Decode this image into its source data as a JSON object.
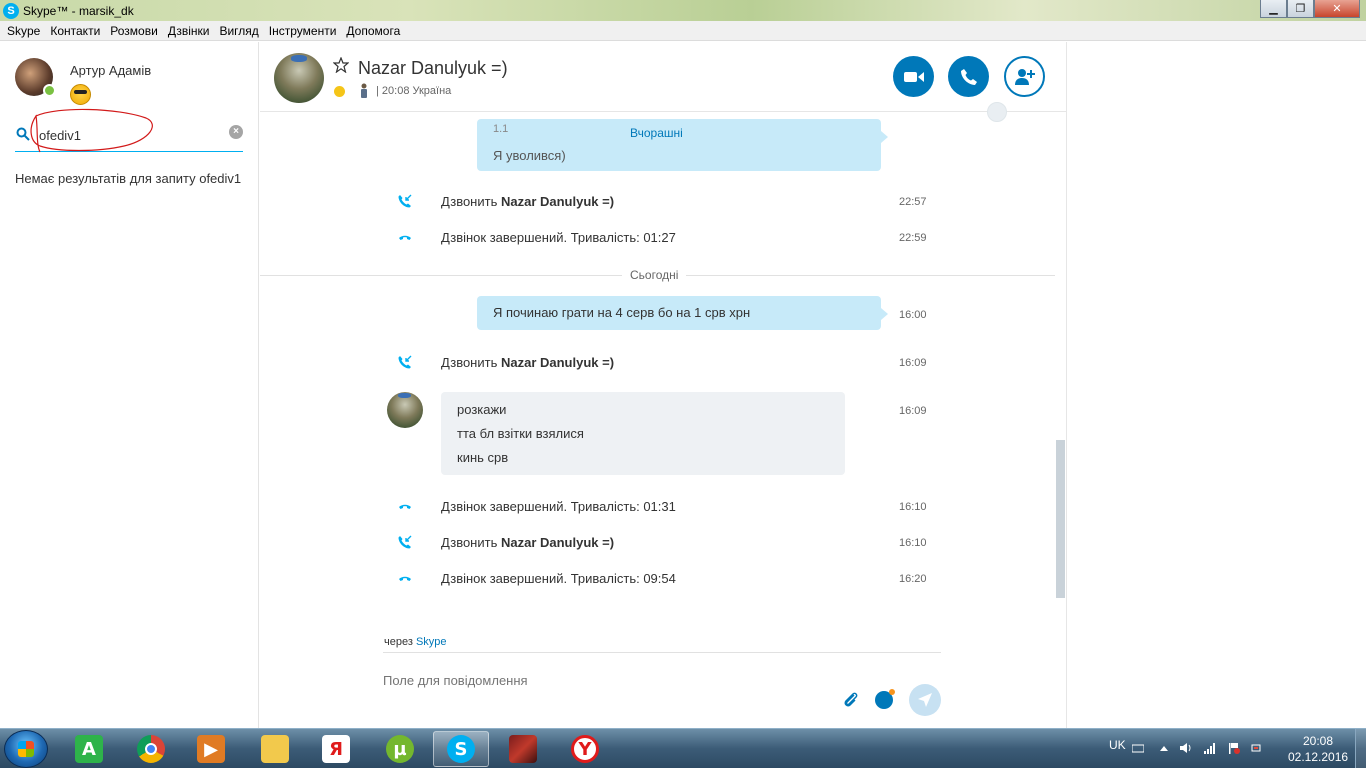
{
  "window": {
    "title": "Skype™ - marsik_dk",
    "minimize": "▁",
    "maximize": "❐",
    "close": "✕"
  },
  "menu": [
    "Skype",
    "Контакти",
    "Розмови",
    "Дзвінки",
    "Вигляд",
    "Інструменти",
    "Допомога"
  ],
  "profile": {
    "name": "Артур Адамів"
  },
  "search": {
    "value": "ofediv1",
    "no_results": "Немає результатів для запиту ofediv1"
  },
  "conversation": {
    "contact_name": "Nazar Danulyuk =)",
    "local_time": "| 20:08 Україна",
    "date_yesterday": "Вчорашні",
    "partial_top_1": "1.1",
    "partial_top_2": "Я уволився)",
    "date_today": "Сьогодні",
    "events_yesterday": [
      {
        "type": "incoming-call",
        "prefix": "Дзвонить ",
        "name": "Nazar Danulyuk =)",
        "time": "22:57"
      },
      {
        "type": "call-ended",
        "text": "Дзвінок завершений. Тривалість: 01:27",
        "time": "22:59"
      }
    ],
    "outgoing_message": {
      "text": "Я починаю грати на 4 серв бо на 1 срв хрн",
      "time": "16:00"
    },
    "event_call_1": {
      "prefix": "Дзвонить ",
      "name": "Nazar Danulyuk =)",
      "time": "16:09"
    },
    "incoming_message": {
      "lines": [
        "розкажи",
        "тта бл взітки взялися",
        "кинь срв"
      ],
      "time": "16:09"
    },
    "events_today": [
      {
        "type": "call-ended",
        "text": "Дзвінок завершений. Тривалість: 01:31",
        "time": "16:10"
      },
      {
        "type": "incoming-call",
        "prefix": "Дзвонить ",
        "name": "Nazar Danulyuk =)",
        "time": "16:10"
      },
      {
        "type": "call-ended",
        "text": "Дзвінок завершений. Тривалість: 09:54",
        "time": "16:20"
      }
    ],
    "via_prefix": "через ",
    "via_link": "Skype",
    "compose_placeholder": "Поле для повідомлення"
  },
  "taskbar": {
    "apps": [
      "green-a-app",
      "chrome",
      "media-player",
      "file-explorer",
      "yandex",
      "utorrent",
      "skype",
      "image-viewer",
      "yandex-browser"
    ],
    "lang": "UK",
    "time": "20:08",
    "date": "02.12.2016"
  },
  "colors": {
    "accent": "#0078b9",
    "outgoing_bubble": "#c7eaf9",
    "incoming_bubble": "#eef1f4"
  }
}
